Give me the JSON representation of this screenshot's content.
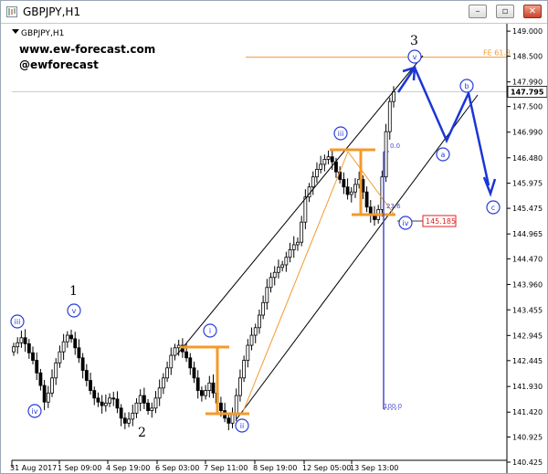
{
  "window": {
    "title": "GBPJPY,H1",
    "minimize_glyph": "–",
    "restore_glyph": "▫",
    "close_glyph": "✕"
  },
  "chart_label": "GBPJPY,H1",
  "watermark": {
    "site": "www.ew-forecast.com",
    "handle": "@ewforecast"
  },
  "colors": {
    "candles": "#000000",
    "channel": "#000000",
    "orange": "#f39a2b",
    "fib_line": "#4a4ad0",
    "projection": "#1a36d6",
    "wave_circle": "#2b3fd6",
    "support_box": "#e02020",
    "grid_line": "#c8c8c8"
  },
  "chart_data": {
    "type": "candlestick",
    "symbol": "GBPJPY",
    "timeframe": "H1",
    "ylim": [
      140.425,
      149.02
    ],
    "yticks": [
      "149.000",
      "148.500",
      "147.990",
      "147.500",
      "146.990",
      "146.480",
      "145.975",
      "145.475",
      "144.965",
      "144.470",
      "143.960",
      "143.455",
      "142.945",
      "142.445",
      "141.930",
      "141.420",
      "140.925",
      "140.425"
    ],
    "xticks": [
      "31 Aug 2017",
      "1 Sep 09:00",
      "4 Sep 19:00",
      "6 Sep 03:00",
      "7 Sep 11:00",
      "8 Sep 19:00",
      "12 Sep 05:00",
      "13 Sep 13:00"
    ],
    "current_price": "147.795",
    "fe_level": {
      "label": "FE 61.8",
      "price": 148.5
    },
    "support_level": "145.185",
    "fib_labels": {
      "top": "0.0",
      "mid": "23.6",
      "bottom": "100.0"
    },
    "closes": [
      142.72,
      142.8,
      142.9,
      142.78,
      142.6,
      142.45,
      142.2,
      141.95,
      141.62,
      141.8,
      142.1,
      142.4,
      142.62,
      142.82,
      142.95,
      142.88,
      142.7,
      142.5,
      142.25,
      142.05,
      141.85,
      141.7,
      141.62,
      141.55,
      141.6,
      141.7,
      141.68,
      141.5,
      141.3,
      141.2,
      141.28,
      141.4,
      141.6,
      141.75,
      141.6,
      141.45,
      141.5,
      141.7,
      141.9,
      142.1,
      142.3,
      142.55,
      142.7,
      142.75,
      142.62,
      142.5,
      142.3,
      142.1,
      141.85,
      141.75,
      141.85,
      142.0,
      141.8,
      141.6,
      141.45,
      141.3,
      141.2,
      141.4,
      141.75,
      142.1,
      142.45,
      142.75,
      142.95,
      143.1,
      143.35,
      143.6,
      143.9,
      144.1,
      144.2,
      144.3,
      144.35,
      144.5,
      144.65,
      144.75,
      144.8,
      145.2,
      145.7,
      145.9,
      146.1,
      146.25,
      146.35,
      146.45,
      146.5,
      146.4,
      146.2,
      146.05,
      145.9,
      145.75,
      145.8,
      145.95,
      146.05,
      145.8,
      145.5,
      145.35,
      145.25,
      145.45,
      146.1,
      147.0,
      147.6,
      147.795
    ],
    "wave_labels": {
      "w1": "1",
      "w2": "2",
      "w3": "3",
      "iii_left": "iii",
      "v_left": "v",
      "iv_left": "iv",
      "i": "i",
      "ii": "ii",
      "iii": "iii",
      "iv": "iv",
      "v": "v",
      "a": "a",
      "b": "b",
      "c": "c"
    }
  }
}
